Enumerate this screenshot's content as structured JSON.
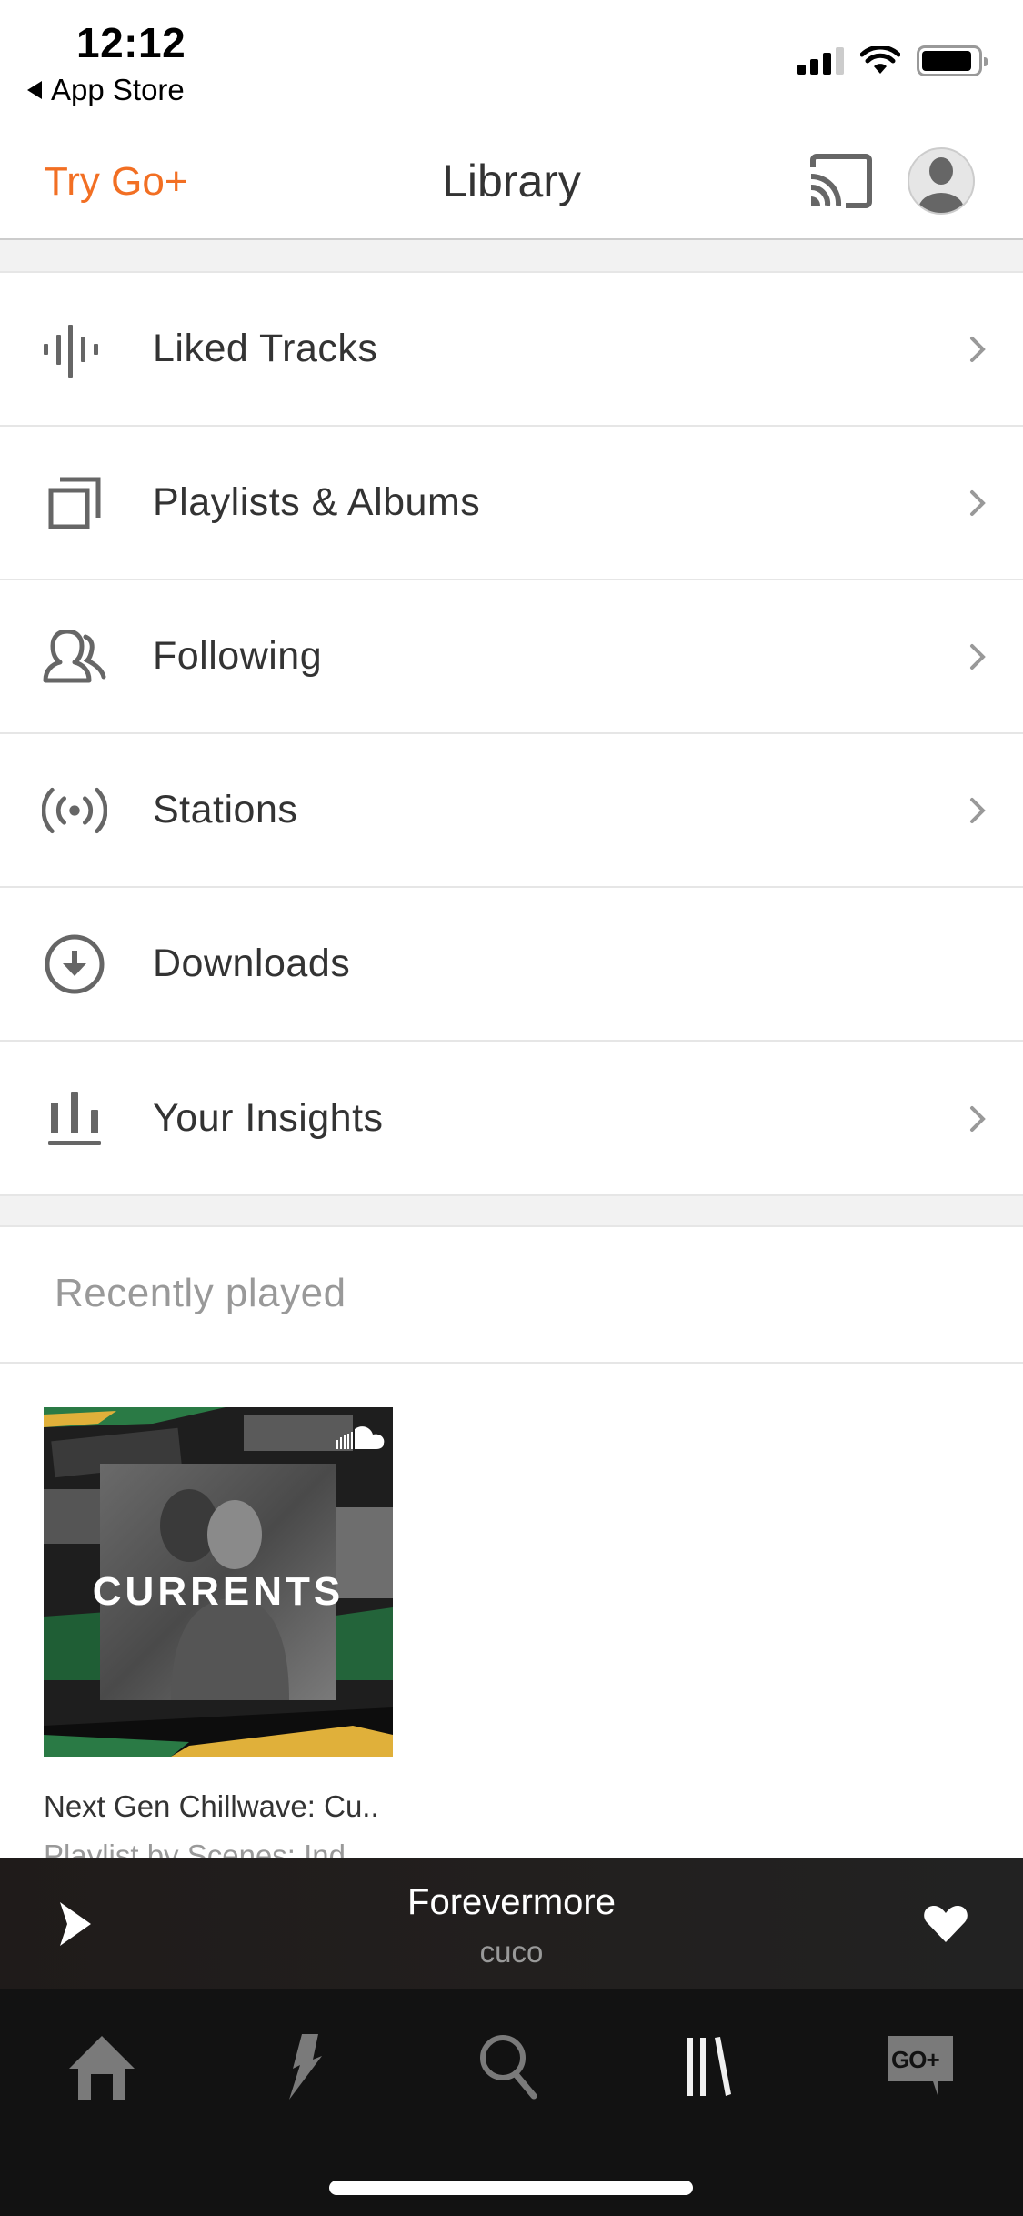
{
  "status_bar": {
    "time": "12:12",
    "back_label": "App Store",
    "signal_bars_active": 3,
    "signal_bars_total": 4,
    "battery_level": 0.9
  },
  "header": {
    "upsell_label": "Try Go+",
    "title": "Library",
    "cast_icon": "cast-icon",
    "avatar_icon": "user-avatar-icon"
  },
  "colors": {
    "accent": "#f26f23",
    "text_primary": "#333333",
    "text_secondary": "#999999",
    "icon_gray": "#666666",
    "band_gray": "#f2f2f2",
    "player_bg": "#201d1c",
    "tabbar_bg": "#121212"
  },
  "menu": {
    "items": [
      {
        "label": "Liked Tracks",
        "icon": "waveform-icon",
        "has_chevron": true
      },
      {
        "label": "Playlists & Albums",
        "icon": "stacked-squares-icon",
        "has_chevron": true
      },
      {
        "label": "Following",
        "icon": "people-icon",
        "has_chevron": true
      },
      {
        "label": "Stations",
        "icon": "broadcast-icon",
        "has_chevron": true
      },
      {
        "label": "Downloads",
        "icon": "download-icon",
        "has_chevron": false
      },
      {
        "label": "Your Insights",
        "icon": "bar-chart-icon",
        "has_chevron": true
      }
    ]
  },
  "recently_played": {
    "title": "Recently played",
    "items": [
      {
        "artwork_text": "CURRENTS",
        "name": "Next Gen Chillwave: Cu..",
        "subtitle": "Playlist by Scenes: Ind"
      }
    ]
  },
  "mini_player": {
    "track": "Forevermore",
    "artist": "cuco",
    "state": "paused",
    "liked": true
  },
  "tab_bar": {
    "tabs": [
      {
        "name": "home",
        "icon": "home-icon",
        "active": false
      },
      {
        "name": "stream",
        "icon": "lightning-icon",
        "active": false
      },
      {
        "name": "search",
        "icon": "search-icon",
        "active": false
      },
      {
        "name": "library",
        "icon": "library-icon",
        "active": true
      },
      {
        "name": "go-plus",
        "icon": "go-plus-icon",
        "active": false,
        "badge_text": "GO+"
      }
    ]
  }
}
